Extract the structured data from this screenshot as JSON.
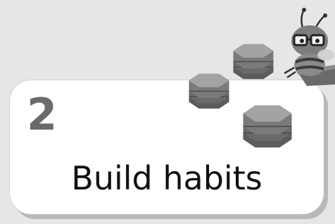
{
  "card": {
    "step_number": "2",
    "title": "Build habits"
  },
  "icons": {
    "decorations": [
      "hexagon-stack-icon",
      "hexagon-stack-icon",
      "hexagon-stack-icon",
      "bee-mascot-icon"
    ]
  },
  "colors": {
    "background": "#e6e6e6",
    "card": "#ffffff",
    "number": "#6b6b6b",
    "title": "#111111",
    "hexagon": "#6f6f6f"
  }
}
